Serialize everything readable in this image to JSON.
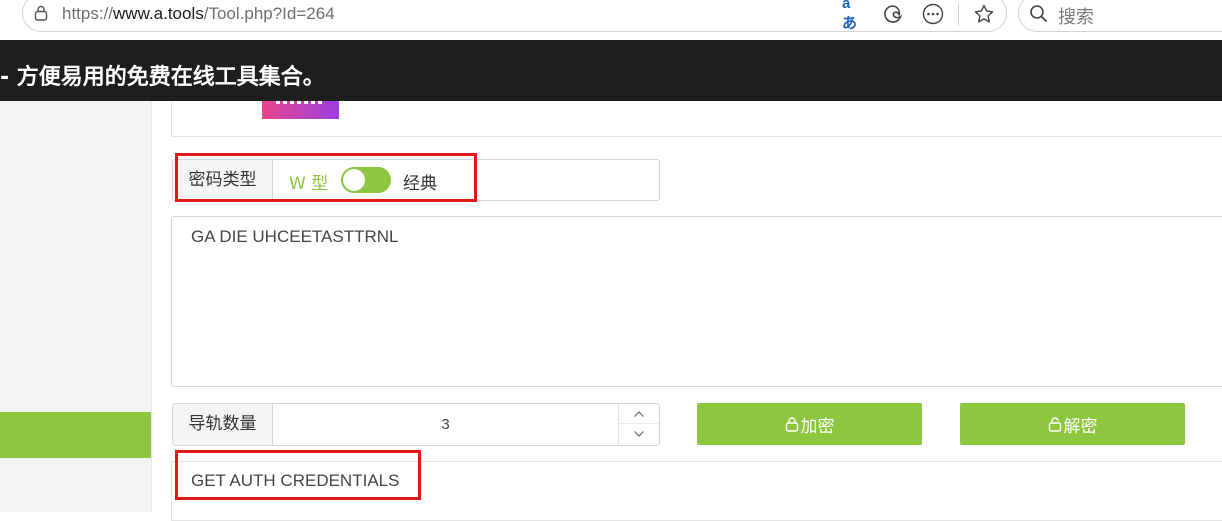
{
  "browser": {
    "url_prefix": "https://",
    "url_host": "www.a.tools",
    "url_path": "/Tool.php?Id=264",
    "read_aloud_label": "aあ",
    "search_placeholder": "搜索"
  },
  "banner": {
    "text": "- 方便易用的免费在线工具集合。"
  },
  "password_type": {
    "label": "密码类型",
    "option_w": "W 型",
    "option_classic": "经典",
    "toggle_state": "on"
  },
  "input_text": "GA DIE UHCEETASTTRNL",
  "rails": {
    "label": "导轨数量",
    "value": "3"
  },
  "buttons": {
    "encrypt": "加密",
    "decrypt": "解密"
  },
  "result_text": "GET AUTH CREDENTIALS",
  "colors": {
    "accent": "#8dc63f",
    "banner_bg": "#1e1e1e",
    "highlight": "#e01818"
  }
}
